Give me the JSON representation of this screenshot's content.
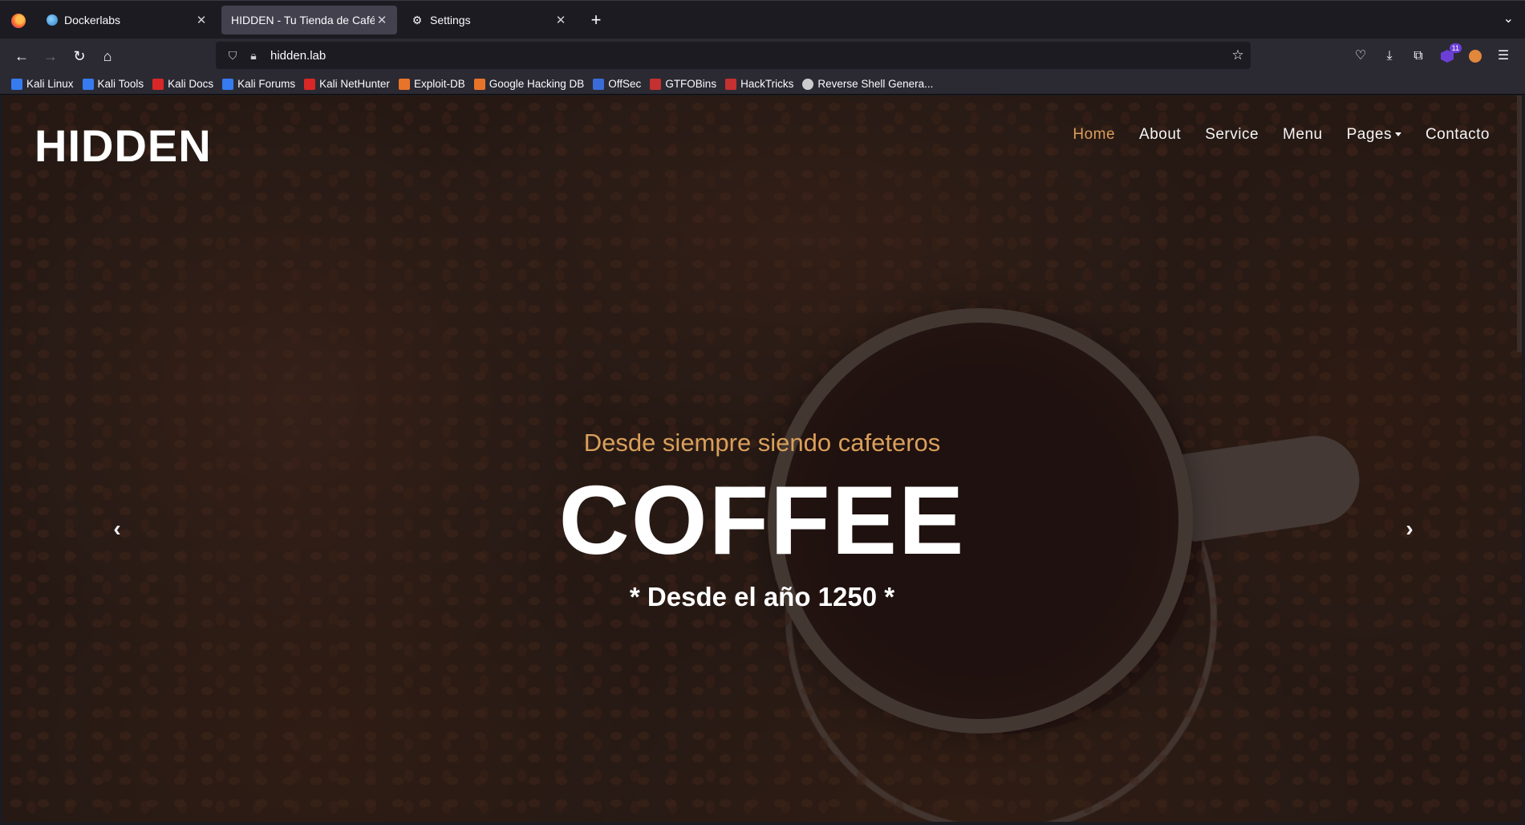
{
  "browser": {
    "tabs": [
      {
        "title": "Dockerlabs",
        "icon": "globe-icon",
        "active": false
      },
      {
        "title": "HIDDEN - Tu Tienda de Cafés",
        "icon": "none",
        "active": true
      },
      {
        "title": "Settings",
        "icon": "gear-icon",
        "active": false
      }
    ],
    "new_tab": "+",
    "url": "hidden.lab",
    "extension_badge": "11",
    "bookmarks": [
      {
        "label": "Kali Linux",
        "color": "#367bf0"
      },
      {
        "label": "Kali Tools",
        "color": "#367bf0"
      },
      {
        "label": "Kali Docs",
        "color": "#d92727"
      },
      {
        "label": "Kali Forums",
        "color": "#367bf0"
      },
      {
        "label": "Kali NetHunter",
        "color": "#d92727"
      },
      {
        "label": "Exploit-DB",
        "color": "#e8742a"
      },
      {
        "label": "Google Hacking DB",
        "color": "#e8742a"
      },
      {
        "label": "OffSec",
        "color": "#3b6bd6"
      },
      {
        "label": "GTFOBins",
        "color": "#c53030"
      },
      {
        "label": "HackTricks",
        "color": "#c53030"
      },
      {
        "label": "Reverse Shell Genera...",
        "color": "#cccccc"
      }
    ]
  },
  "site": {
    "logo": "HIDDEN",
    "nav": {
      "home": "Home",
      "about": "About",
      "service": "Service",
      "menu": "Menu",
      "pages": "Pages",
      "contact": "Contacto"
    },
    "hero": {
      "subtitle": "Desde siempre siendo cafeteros",
      "title": "COFFEE",
      "tagline": "* Desde el año 1250 *"
    },
    "accent_color": "#da9f5b"
  }
}
